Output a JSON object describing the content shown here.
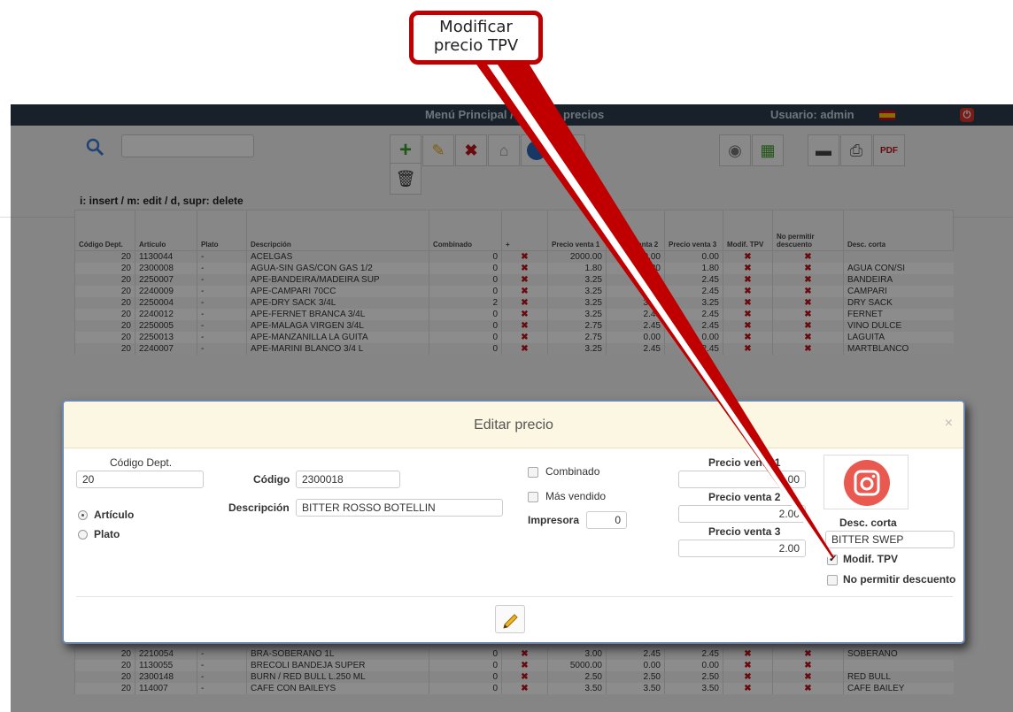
{
  "topbar": {
    "title": "Menú Principal / Lista de precios",
    "user": "Usuario: admin"
  },
  "hint": "i: insert / m: edit / d, supr: delete",
  "table": {
    "headers": [
      "Código Dept.",
      "Artículo",
      "Plato",
      "Descripción",
      "Combinado",
      "+",
      "Precio venta 1",
      "Precio venta 2",
      "Precio venta 3",
      "Modif. TPV",
      "No permitir descuento",
      "Desc. corta"
    ],
    "rows": [
      [
        "20",
        "1130044",
        "-",
        "ACELGAS",
        "0",
        "✖",
        "2000.00",
        "0.00",
        "0.00",
        "✖",
        "✖",
        ""
      ],
      [
        "20",
        "2300008",
        "-",
        "AGUA-SIN GAS/CON GAS 1/2",
        "0",
        "✖",
        "1.80",
        "1.80",
        "1.80",
        "✖",
        "✖",
        "AGUA CON/SI"
      ],
      [
        "20",
        "2250007",
        "-",
        "APE-BANDEIRA/MADEIRA SUP",
        "0",
        "✖",
        "3.25",
        "2.45",
        "2.45",
        "✖",
        "✖",
        "BANDEIRA"
      ],
      [
        "20",
        "2240009",
        "-",
        "APE-CAMPARI 70CC",
        "0",
        "✖",
        "3.25",
        "2.45",
        "2.45",
        "✖",
        "✖",
        "CAMPARI"
      ],
      [
        "20",
        "2250004",
        "-",
        "APE-DRY SACK 3/4L",
        "2",
        "✖",
        "3.25",
        "3.25",
        "3.25",
        "✖",
        "✖",
        "DRY SACK"
      ],
      [
        "20",
        "2240012",
        "-",
        "APE-FERNET BRANCA 3/4L",
        "0",
        "✖",
        "3.25",
        "2.45",
        "2.45",
        "✖",
        "✖",
        "FERNET"
      ],
      [
        "20",
        "2250005",
        "-",
        "APE-MALAGA VIRGEN 3/4L",
        "0",
        "✖",
        "2.75",
        "2.45",
        "2.45",
        "✖",
        "✖",
        "VINO DULCE"
      ],
      [
        "20",
        "2250013",
        "-",
        "APE-MANZANILLA LA GUITA",
        "0",
        "✖",
        "2.75",
        "0.00",
        "0.00",
        "✖",
        "✖",
        "LAGUITA"
      ],
      [
        "20",
        "2240007",
        "-",
        "APE-MARINI BLANCO 3/4 L",
        "0",
        "✖",
        "3.25",
        "2.45",
        "2.45",
        "✖",
        "✖",
        "MARTBLANCO"
      ]
    ],
    "bottom_rows": [
      [
        "20",
        "2210054",
        "-",
        "BRA-SOBERANO 1L",
        "0",
        "✖",
        "3.00",
        "2.45",
        "2.45",
        "✖",
        "✖",
        "SOBERANO"
      ],
      [
        "20",
        "1130055",
        "-",
        "BRECOLI BANDEJA SUPER",
        "0",
        "✖",
        "5000.00",
        "0.00",
        "0.00",
        "✖",
        "✖",
        ""
      ],
      [
        "20",
        "2300148",
        "-",
        "BURN / RED BULL L.250 ML",
        "0",
        "✖",
        "2.50",
        "2.50",
        "2.50",
        "✖",
        "✖",
        "RED BULL"
      ],
      [
        "20",
        "114007",
        "-",
        "CAFE CON BAILEYS",
        "0",
        "✖",
        "3.50",
        "3.50",
        "3.50",
        "✖",
        "✖",
        "CAFE BAILEY"
      ]
    ]
  },
  "modal": {
    "title": "Editar precio",
    "close": "×",
    "codigo_dept_label": "Código Dept.",
    "codigo_dept_value": "20",
    "codigo_label": "Código",
    "codigo_value": "2300018",
    "descripcion_label": "Descripción",
    "descripcion_value": "BITTER ROSSO BOTELLIN",
    "articulo_label": "Artículo",
    "plato_label": "Plato",
    "combinado_label": "Combinado",
    "mas_vendido_label": "Más vendido",
    "impresora_label": "Impresora",
    "impresora_value": "0",
    "precio1_label": "Precio venta 1",
    "precio1_value": "2.00",
    "precio2_label": "Precio venta 2",
    "precio2_value": "2.00",
    "precio3_label": "Precio venta 3",
    "precio3_value": "2.00",
    "desc_corta_label": "Desc. corta",
    "desc_corta_value": "BITTER SWEP",
    "modif_tpv_label": "Modif. TPV",
    "modif_tpv_checked": true,
    "no_descuento_label": "No permitir descuento"
  },
  "callout": {
    "line1": "Modificar",
    "line2": "precio TPV"
  },
  "colors": {
    "annotation": "#c00000",
    "header_bg": "#2d3b4c",
    "delete_red": "#c0141b",
    "modal_border": "#6d87ad"
  }
}
